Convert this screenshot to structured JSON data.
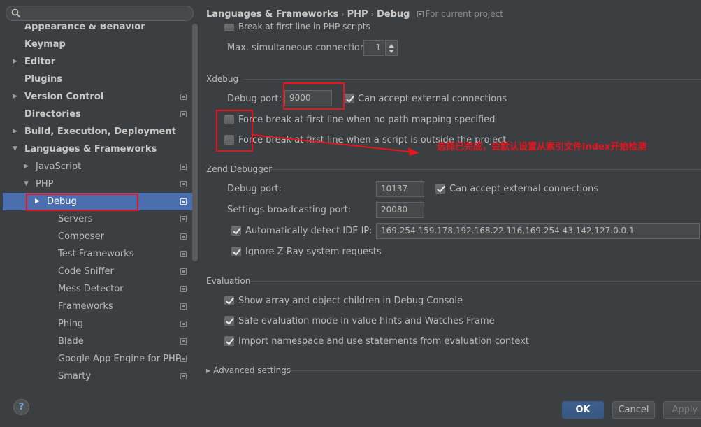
{
  "search": {
    "placeholder": ""
  },
  "tree": {
    "items": [
      {
        "label": "Appearance & Behavior",
        "bold": true,
        "arrow": "",
        "icon": false
      },
      {
        "label": "Keymap",
        "bold": true,
        "arrow": "",
        "icon": false
      },
      {
        "label": "Editor",
        "bold": true,
        "arrow": "▶",
        "icon": false
      },
      {
        "label": "Plugins",
        "bold": true,
        "arrow": "",
        "icon": false
      },
      {
        "label": "Version Control",
        "bold": true,
        "arrow": "▶",
        "icon": true
      },
      {
        "label": "Directories",
        "bold": true,
        "arrow": "",
        "icon": true
      },
      {
        "label": "Build, Execution, Deployment",
        "bold": true,
        "arrow": "▶",
        "icon": false
      },
      {
        "label": "Languages & Frameworks",
        "bold": true,
        "arrow": "▼",
        "icon": false
      },
      {
        "label": "JavaScript",
        "bold": false,
        "arrow": "▶",
        "icon": true
      },
      {
        "label": "PHP",
        "bold": false,
        "arrow": "▼",
        "icon": true
      },
      {
        "label": "Debug",
        "bold": false,
        "arrow": "▶",
        "icon": true,
        "selected": true
      },
      {
        "label": "Servers",
        "bold": false,
        "arrow": "",
        "icon": true
      },
      {
        "label": "Composer",
        "bold": false,
        "arrow": "",
        "icon": true
      },
      {
        "label": "Test Frameworks",
        "bold": false,
        "arrow": "",
        "icon": true
      },
      {
        "label": "Code Sniffer",
        "bold": false,
        "arrow": "",
        "icon": true
      },
      {
        "label": "Mess Detector",
        "bold": false,
        "arrow": "",
        "icon": true
      },
      {
        "label": "Frameworks",
        "bold": false,
        "arrow": "",
        "icon": true
      },
      {
        "label": "Phing",
        "bold": false,
        "arrow": "",
        "icon": true
      },
      {
        "label": "Blade",
        "bold": false,
        "arrow": "",
        "icon": true
      },
      {
        "label": "Google App Engine for PHP",
        "bold": false,
        "arrow": "",
        "icon": true
      },
      {
        "label": "Smarty",
        "bold": false,
        "arrow": "",
        "icon": true
      }
    ]
  },
  "help": {
    "label": "?"
  },
  "breadcrumb": {
    "items": [
      "Languages & Frameworks",
      "PHP",
      "Debug"
    ],
    "separator": "›",
    "scope": "For current project"
  },
  "top": {
    "break_first_line_php": "Break at first line in PHP scripts",
    "max_connections_label": "Max. simultaneous connections:",
    "max_connections_value": "1"
  },
  "xdebug": {
    "title": "Xdebug",
    "port_label": "Debug port:",
    "port_value": "9000",
    "accept_external": "Can accept external connections",
    "force_break_no_mapping": "Force break at first line when no path mapping specified",
    "force_break_outside": "Force break at first line when a script is outside the project"
  },
  "annotation": {
    "text": "选择已完成，会默认设置从索引文件index开始检测"
  },
  "zend": {
    "title": "Zend Debugger",
    "port_label": "Debug port:",
    "port_value": "10137",
    "accept_external": "Can accept external connections",
    "broadcast_label": "Settings broadcasting port:",
    "broadcast_value": "20080",
    "auto_detect_label": "Automatically detect IDE IP:",
    "auto_detect_value": "169.254.159.178,192.168.22.116,169.254.43.142,127.0.0.1",
    "ignore_zray": "Ignore Z-Ray system requests"
  },
  "evaluation": {
    "title": "Evaluation",
    "show_array": "Show array and object children in Debug Console",
    "safe_eval": "Safe evaluation mode in value hints and Watches Frame",
    "import_namespace": "Import namespace and use statements from evaluation context"
  },
  "advanced": {
    "label": "Advanced settings"
  },
  "buttons": {
    "ok": "OK",
    "cancel": "Cancel",
    "apply": "Apply"
  },
  "colors": {
    "selection": "#4b6eaf",
    "annotation_red": "#e8141f",
    "background": "#3c3f41"
  }
}
